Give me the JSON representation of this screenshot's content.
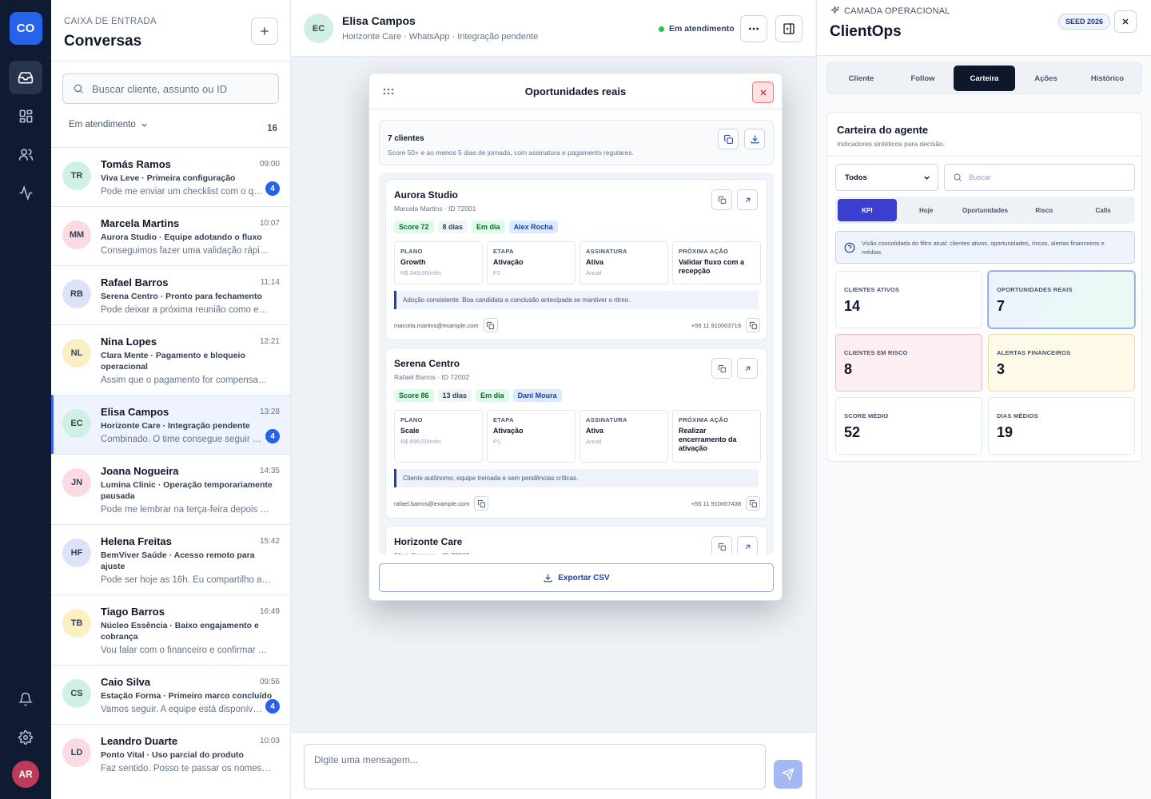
{
  "rail": {
    "logo": "CO",
    "user_initials": "AR"
  },
  "inbox": {
    "kicker": "CAIXA DE ENTRADA",
    "title": "Conversas",
    "search_placeholder": "Buscar cliente, assunto ou ID",
    "filter_label": "Em atendimento",
    "count": "16",
    "conversations": [
      {
        "initials": "TR",
        "name": "Tomás Ramos",
        "time": "09:00",
        "subtitle": "Viva Leve · Primeira configuração",
        "message": "Pode me enviar um checklist com o que preciso",
        "badge": "4",
        "color": "#d1f0e4"
      },
      {
        "initials": "MM",
        "name": "Marcela Martins",
        "time": "10:07",
        "subtitle": "Aurora Studio · Equipe adotando o fluxo",
        "message": "Conseguimos fazer uma validação rápida amanhã",
        "badge": "",
        "color": "#fbdbe3"
      },
      {
        "initials": "RB",
        "name": "Rafael Barros",
        "time": "11:14",
        "subtitle": "Serena Centro · Pronto para fechamento",
        "message": "Pode deixar a próxima reunião como encerramento",
        "badge": "",
        "color": "#dde3f7"
      },
      {
        "initials": "NL",
        "name": "Nina Lopes",
        "time": "12:21",
        "subtitle": "Clara Mente · Pagamento e bloqueio operacional",
        "message": "Assim que o pagamento for compensado eu aviso",
        "badge": "",
        "color": "#fbefc4"
      },
      {
        "initials": "EC",
        "name": "Elisa Campos",
        "time": "13:28",
        "subtitle": "Horizonte Care · Integração pendente",
        "message": "Combinado. O time consegue seguir pelo WhatsApp",
        "badge": "4",
        "color": "#d1f0e4"
      },
      {
        "initials": "JN",
        "name": "Joana Nogueira",
        "time": "14:35",
        "subtitle": "Lumina Clinic · Operação temporariamente pausada",
        "message": "Pode me lembrar na terça-feira depois das 10h?",
        "badge": "",
        "color": "#fbdbe3"
      },
      {
        "initials": "HF",
        "name": "Helena Freitas",
        "time": "15:42",
        "subtitle": "BemViver Saúde · Acesso remoto para ajuste",
        "message": "Pode ser hoje as 16h. Eu compartilho a tela.",
        "badge": "",
        "color": "#dde3f7"
      },
      {
        "initials": "TB",
        "name": "Tiago Barros",
        "time": "16:49",
        "subtitle": "Núcleo Essência · Baixo engajamento e cobrança",
        "message": "Vou falar com o financeiro e confirmar uma data",
        "badge": "",
        "color": "#fbefc4"
      },
      {
        "initials": "CS",
        "name": "Caio Silva",
        "time": "09:56",
        "subtitle": "Estação Forma · Primeiro marco concluído",
        "message": "Vamos seguir. A equipe está disponível na quinta",
        "badge": "4",
        "color": "#d1f0e4"
      },
      {
        "initials": "LD",
        "name": "Leandro Duarte",
        "time": "10:03",
        "subtitle": "Ponto Vital · Uso parcial do produto",
        "message": "Faz sentido. Posso te passar os nomes dos usuários",
        "badge": "",
        "color": "#fbdbe3"
      }
    ]
  },
  "chat": {
    "initials": "EC",
    "name": "Elisa Campos",
    "subtitle": "Horizonte Care · WhatsApp · Integração pendente",
    "status": "Em atendimento",
    "composer_placeholder": "Digite uma mensagem..."
  },
  "modal": {
    "title": "Oportunidades reais",
    "summary_title": "7 clientes",
    "summary_desc": "Score 50+ e ao menos 5 dias de jornada, com assinatura e pagamento regulares.",
    "export_label": "Exportar CSV",
    "cards": [
      {
        "name": "Aurora Studio",
        "sub": "Marcela Martins · ID 72001",
        "tags": [
          "Score 72",
          "8 dias",
          "Em dia",
          "Alex Rocha"
        ],
        "cells": [
          {
            "label": "PLANO",
            "value": "Growth",
            "sub": "R$ 349,00/mês"
          },
          {
            "label": "ETAPA",
            "value": "Ativação",
            "sub": "P2"
          },
          {
            "label": "ASSINATURA",
            "value": "Ativa",
            "sub": "Anual"
          },
          {
            "label": "PRÓXIMA AÇÃO",
            "value": "Validar fluxo com a recepção",
            "sub": ""
          }
        ],
        "note": "Adoção consistente. Boa candidata a conclusão antecipada se mantiver o ritmo.",
        "email": "marcela.martins@example.com",
        "phone": "+55 11 910003719"
      },
      {
        "name": "Serena Centro",
        "sub": "Rafael Barros · ID 72002",
        "tags": [
          "Score 86",
          "13 dias",
          "Em dia",
          "Dani Moura"
        ],
        "cells": [
          {
            "label": "PLANO",
            "value": "Scale",
            "sub": "R$ 699,00/mês"
          },
          {
            "label": "ETAPA",
            "value": "Ativação",
            "sub": "P1"
          },
          {
            "label": "ASSINATURA",
            "value": "Ativa",
            "sub": "Anual"
          },
          {
            "label": "PRÓXIMA AÇÃO",
            "value": "Realizar encerramento da ativação",
            "sub": ""
          }
        ],
        "note": "Cliente autônomo, equipe treinada e sem pendências críticas.",
        "email": "rafael.barros@example.com",
        "phone": "+55 11 910007438"
      },
      {
        "name": "Horizonte Care",
        "sub": "Elisa Campos · ID 72003"
      }
    ]
  },
  "panel": {
    "kicker": "CAMADA OPERACIONAL",
    "title": "ClientOps",
    "seed": "SEED 2026",
    "tabs": [
      "Cliente",
      "Follow",
      "Carteira",
      "Ações",
      "Histórico"
    ],
    "active_tab": 2,
    "wallet_title": "Carteira do agente",
    "wallet_sub": "Indicadores sintéticos para decisão.",
    "select_value": "Todos",
    "search_placeholder": "Buscar",
    "subtabs": [
      "KPI",
      "Hoje",
      "Oportunidades",
      "Risco",
      "Calls"
    ],
    "active_subtab": 0,
    "info": "Visão consolidada do filtro atual: clientes ativos, oportunidades, riscos, alertas financeiros e médias.",
    "kpis": [
      {
        "label": "CLIENTES ATIVOS",
        "value": "14"
      },
      {
        "label": "OPORTUNIDADES REAIS",
        "value": "7"
      },
      {
        "label": "CLIENTES EM RISCO",
        "value": "8"
      },
      {
        "label": "ALERTAS FINANCEIROS",
        "value": "3"
      },
      {
        "label": "SCORE MÉDIO",
        "value": "52"
      },
      {
        "label": "DIAS MÉDIOS",
        "value": "19"
      }
    ]
  }
}
